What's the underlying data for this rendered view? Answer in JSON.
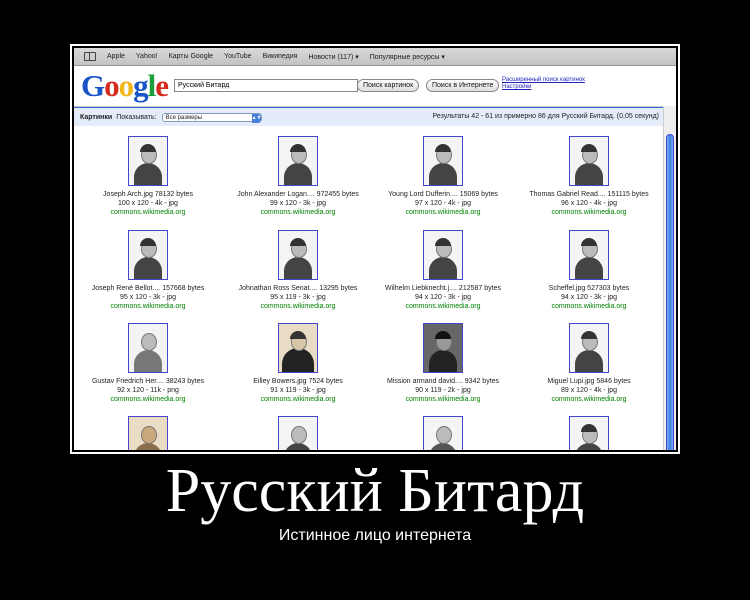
{
  "bookmarks": [
    "Apple",
    "Yahoo!",
    "Карты Google",
    "YouTube",
    "Википедия",
    "Новости (117) ▾",
    "Популярные ресурсы ▾"
  ],
  "logo_letters": [
    "G",
    "o",
    "o",
    "g",
    "l",
    "e"
  ],
  "search": {
    "value": "Русский Битард"
  },
  "buttons": {
    "images": "Поиск картинок",
    "web": "Поиск в Интернете"
  },
  "advanced": {
    "adv_search": "Расширенный поиск картинок",
    "settings": "Настройки"
  },
  "results_bar": {
    "section": "Картинки",
    "show_label": "Показывать:",
    "size_select": "Все размеры",
    "results_text": "Результаты 42 - 61 из примерно 86 для Русский Битард. (0,05 секунд)"
  },
  "images": [
    {
      "title": "Joseph Arch.jpg 78132 bytes",
      "dims": "100 x 120 - 4k - jpg",
      "host": "commons.wikimedia.org"
    },
    {
      "title": "John Alexander Logan.... 972455 bytes",
      "dims": "99 x 120 - 3k - jpg",
      "host": "commons.wikimedia.org"
    },
    {
      "title": "Young Lord Dufferin.... 15069 bytes",
      "dims": "97 x 120 - 4k - jpg",
      "host": "commons.wikimedia.org"
    },
    {
      "title": "Thomas Gabriel Read.... 151115 bytes",
      "dims": "96 x 120 - 4k - jpg",
      "host": "commons.wikimedia.org"
    },
    {
      "title": "Joseph René Bellot.... 157668 bytes",
      "dims": "95 x 120 - 3k - jpg",
      "host": "commons.wikimedia.org"
    },
    {
      "title": "Johnathan Ross Senat.... 13295 bytes",
      "dims": "95 x 119 - 3k - jpg",
      "host": "commons.wikimedia.org"
    },
    {
      "title": "Wilhelm Liebknecht.j.... 212587 bytes",
      "dims": "94 x 120 - 3k - jpg",
      "host": "commons.wikimedia.org"
    },
    {
      "title": "Scheffel.jpg 527303 bytes",
      "dims": "94 x 120 - 3k - jpg",
      "host": "commons.wikimedia.org"
    },
    {
      "title": "Gustav Friedrich Her.... 38243 bytes",
      "dims": "92 x 120 - 11k - png",
      "host": "commons.wikimedia.org"
    },
    {
      "title": "Eilley Bowers.jpg 7524 bytes",
      "dims": "91 x 119 - 3k - jpg",
      "host": "commons.wikimedia.org"
    },
    {
      "title": "Mission armand david.... 9342 bytes",
      "dims": "90 x 119 - 2k - jpg",
      "host": "commons.wikimedia.org"
    },
    {
      "title": "Miguel Lupi.jpg 5846 bytes",
      "dims": "89 x 120 - 4k - jpg",
      "host": "commons.wikimedia.org"
    }
  ],
  "caption": {
    "title": "Русский Битард",
    "subtitle": "Истинное лицо интернета"
  }
}
